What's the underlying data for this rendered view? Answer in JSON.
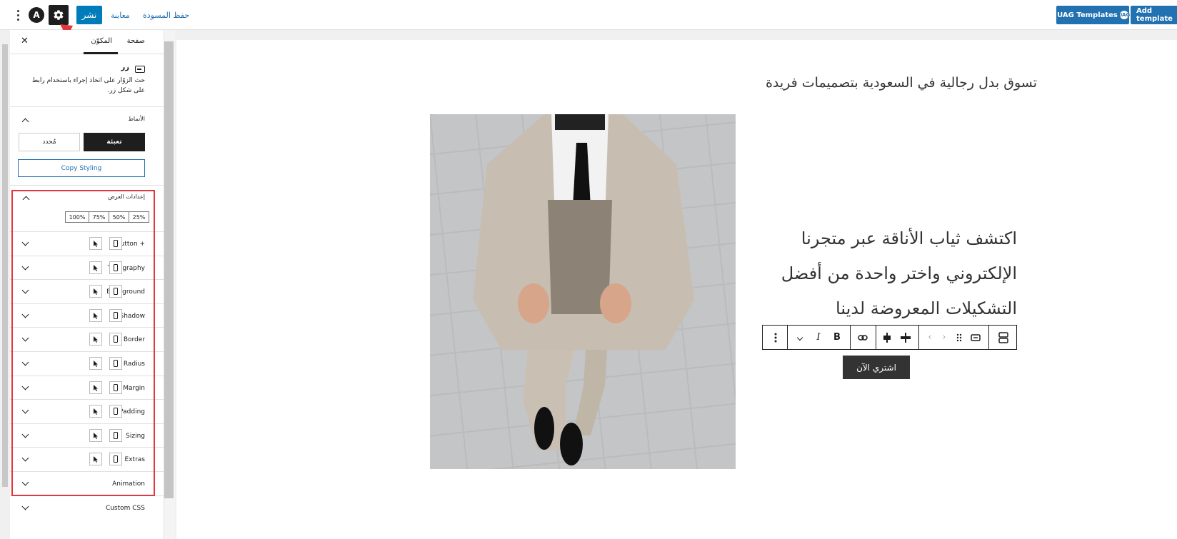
{
  "topbar": {
    "publish_label": "نشر",
    "preview_label": "معاينة",
    "save_draft_label": "حفظ المسودة",
    "uag_templates_label": "UAG Templates",
    "uag_badge": "UAG",
    "add_template_label": "Add template",
    "logo_glyph": "A"
  },
  "sidebar": {
    "tabs": {
      "page": "صفحة",
      "block": "المكوّن"
    },
    "close_glyph": "✕",
    "block": {
      "name": "زر",
      "description": "حث الزوّار على اتخاذ إجراء باستخدام رابط على شكل زر."
    },
    "styles": {
      "title": "الأنماط",
      "fill": "تعبئة",
      "outline": "مُحدد",
      "copy_styling": "Copy Styling"
    },
    "width_settings": {
      "title": "إعدادات العرض",
      "options": [
        "100%",
        "75%",
        "50%",
        "25%"
      ]
    },
    "panels": [
      "Button +",
      "Typography",
      "Background",
      "Shadow",
      "Border",
      "Radius",
      "Margin",
      "Padding",
      "Sizing",
      "Extras",
      "Animation",
      "Custom CSS"
    ]
  },
  "canvas": {
    "headline": "تسوق بدل رجالية في السعودية بتصميمات فريدة",
    "body_lines": [
      "اكتشف ثياب الأناقة عبر متجرنا",
      "الإلكتروني واختر واحدة من أفضل",
      "التشكيلات المعروضة لدينا"
    ],
    "cta_label": "اشتري الآن",
    "toolbar": {
      "bold": "B",
      "italic": "I"
    }
  },
  "colors": {
    "primary": "#007cba",
    "uag_blue": "#2271b1",
    "highlight_red": "#e0383e",
    "dark": "#1e1e1e"
  }
}
